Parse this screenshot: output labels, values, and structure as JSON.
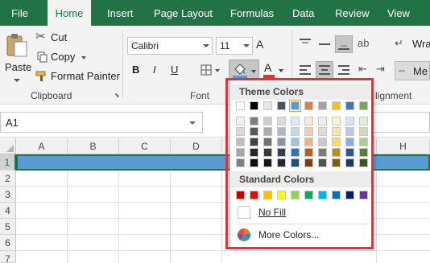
{
  "tabs": [
    {
      "label": "File",
      "active": false
    },
    {
      "label": "Home",
      "active": true
    },
    {
      "label": "Insert",
      "active": false
    },
    {
      "label": "Page Layout",
      "active": false
    },
    {
      "label": "Formulas",
      "active": false
    },
    {
      "label": "Data",
      "active": false
    },
    {
      "label": "Review",
      "active": false
    },
    {
      "label": "View",
      "active": false
    }
  ],
  "clipboard": {
    "paste_label": "Paste",
    "cut_label": "Cut",
    "copy_label": "Copy",
    "format_painter_label": "Format Painter",
    "group_label": "Clipboard"
  },
  "font": {
    "font_name": "Calibri",
    "font_size": "11",
    "group_label": "Font"
  },
  "alignment": {
    "wrap_label": "Wra",
    "merge_label": "Me",
    "group_label": "lignment"
  },
  "formula_bar": {
    "name_box_value": "A1"
  },
  "grid": {
    "columns": [
      "A",
      "B",
      "C",
      "D",
      "H"
    ],
    "rows": [
      "1",
      "2",
      "3",
      "4",
      "5",
      "6",
      "7"
    ]
  },
  "fill_menu": {
    "theme_header": "Theme Colors",
    "standard_header": "Standard Colors",
    "no_fill_label": "No Fill",
    "more_colors_label": "More Colors...",
    "theme_top_row": [
      "#ffffff",
      "#000000",
      "#e7e6e6",
      "#44546a",
      "#5b9bd5",
      "#ed7d31",
      "#a5a5a5",
      "#ffc000",
      "#4472c4",
      "#70ad47"
    ],
    "theme_shades": [
      [
        "#f2f2f2",
        "#7f7f7f",
        "#d0cece",
        "#d6dce5",
        "#deebf7",
        "#fbe5d6",
        "#ededed",
        "#fff2cc",
        "#dae3f3",
        "#e2f0d9"
      ],
      [
        "#d9d9d9",
        "#595959",
        "#aeabab",
        "#adb9ca",
        "#bdd7ee",
        "#f8cbad",
        "#dbdbdb",
        "#ffe699",
        "#b4c7e7",
        "#c5e0b4"
      ],
      [
        "#bfbfbf",
        "#404040",
        "#757171",
        "#8497b0",
        "#9dc3e6",
        "#f4b183",
        "#c9c9c9",
        "#ffd966",
        "#8faadc",
        "#a9d18e"
      ],
      [
        "#a6a6a6",
        "#262626",
        "#3a3838",
        "#333f50",
        "#2e75b6",
        "#c55a11",
        "#7b7b7b",
        "#bf9000",
        "#2f5597",
        "#548235"
      ],
      [
        "#808080",
        "#0d0d0d",
        "#171616",
        "#222a35",
        "#1f4e79",
        "#843c0c",
        "#525252",
        "#7f6000",
        "#203864",
        "#385723"
      ]
    ],
    "standard_colors": [
      "#c00000",
      "#ff0000",
      "#ffc000",
      "#ffff00",
      "#92d050",
      "#00b050",
      "#00b0f0",
      "#0070c0",
      "#002060",
      "#7030a0"
    ]
  },
  "colors": {
    "excel_green": "#217346",
    "selection_fill": "#5b9bd5",
    "highlight_border": "#e2333b"
  }
}
